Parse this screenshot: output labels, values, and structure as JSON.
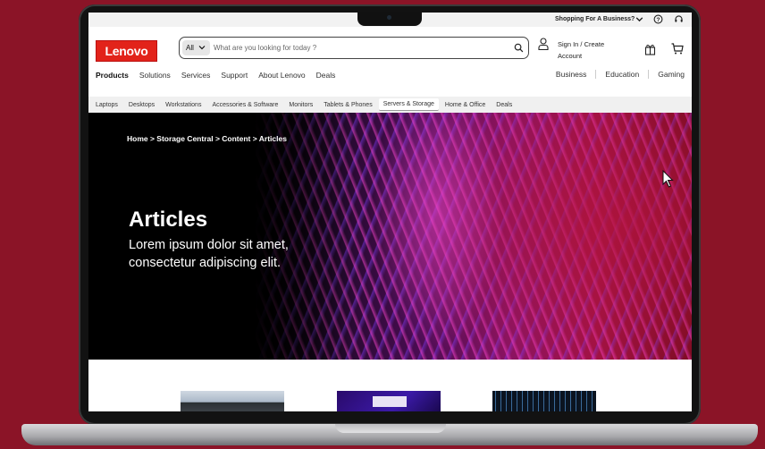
{
  "colors": {
    "page_background": "#8b1427",
    "brand_red": "#e2231a",
    "hero_accent": "#c2177a"
  },
  "util_bar": {
    "business_link": "Shopping For A Business?",
    "icons": [
      "chevron-down-icon",
      "help-icon",
      "headset-icon"
    ]
  },
  "header": {
    "logo_text": "Lenovo",
    "search": {
      "category_label": "All",
      "placeholder": "What are you looking for today ?"
    },
    "account": {
      "line1": "Sign In / Create",
      "line2": "Account"
    },
    "primary_nav": [
      "Products",
      "Solutions",
      "Services",
      "Support",
      "About Lenovo",
      "Deals"
    ],
    "active_primary": "Products",
    "segment_nav": [
      "Business",
      "Education",
      "Gaming"
    ]
  },
  "category_bar": {
    "items": [
      "Laptops",
      "Desktops",
      "Workstations",
      "Accessories & Software",
      "Monitors",
      "Tablets & Phones",
      "Servers & Storage",
      "Home & Office",
      "Deals"
    ],
    "active": "Servers & Storage"
  },
  "hero": {
    "breadcrumb": "Home > Storage Central > Content > Articles",
    "title": "Articles",
    "subtitle_line1": "Lorem ipsum dolor sit amet,",
    "subtitle_line2": "consectetur adipiscing elit."
  }
}
